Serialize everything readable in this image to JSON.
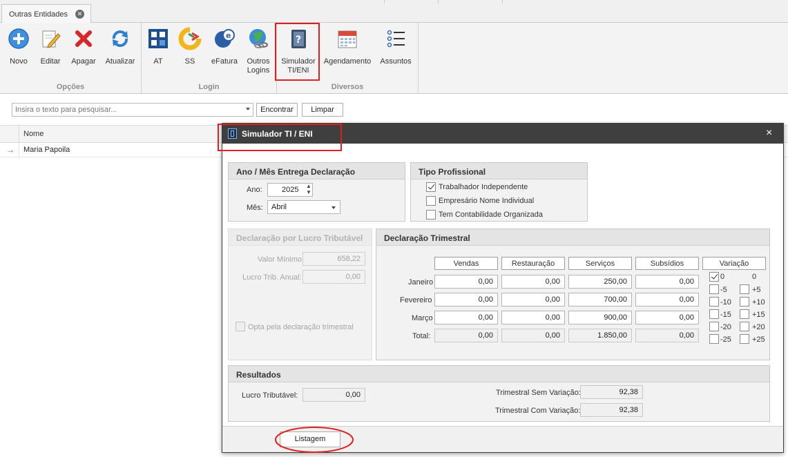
{
  "tab": {
    "label": "Outras Entidades"
  },
  "ribbon": {
    "groups": [
      {
        "title": "Opções",
        "buttons": [
          {
            "label": "Novo"
          },
          {
            "label": "Editar"
          },
          {
            "label": "Apagar"
          },
          {
            "label": "Atualizar"
          }
        ]
      },
      {
        "title": "Login",
        "buttons": [
          {
            "label": "AT"
          },
          {
            "label": "SS"
          },
          {
            "label": "eFatura"
          },
          {
            "label": "Outros\nLogins"
          }
        ]
      },
      {
        "title": "Diversos",
        "buttons": [
          {
            "label": "Simulador\nTI/ENI"
          },
          {
            "label": "Agendamento"
          },
          {
            "label": "Assuntos"
          }
        ]
      }
    ]
  },
  "search": {
    "placeholder": "Insira o texto para pesquisar...",
    "find_label": "Encontrar",
    "clear_label": "Limpar"
  },
  "grid": {
    "column": "Nome",
    "rows": [
      {
        "name": "Maria Papoila"
      }
    ]
  },
  "dialog": {
    "title": "Simulador TI / ENI",
    "close": "×",
    "entrega": {
      "title": "Ano / Mês Entrega Declaração",
      "ano_label": "Ano:",
      "ano_value": "2025",
      "mes_label": "Mês:",
      "mes_value": "Abril"
    },
    "tipo": {
      "title": "Tipo Profissional",
      "options": [
        {
          "label": "Trabalhador Independente",
          "checked": true
        },
        {
          "label": "Empresário Nome Individual",
          "checked": false
        },
        {
          "label": "Tem Contabilidade Organizada",
          "checked": false
        }
      ]
    },
    "lucro": {
      "title": "Declaração por Lucro Tributável",
      "valor_minimo_label": "Valor Mínimo:",
      "valor_minimo": "658,22",
      "lucro_anual_label": "Lucro Trib. Anual:",
      "lucro_anual": "0,00",
      "opta_label": "Opta pela declaração trimestral"
    },
    "trimestral": {
      "title": "Declaração Trimestral",
      "columns": [
        "Vendas",
        "Restauração",
        "Serviços",
        "Subsídios"
      ],
      "variacao_label": "Variação",
      "rows": [
        {
          "label": "Janeiro",
          "values": [
            "0,00",
            "0,00",
            "250,00",
            "0,00"
          ]
        },
        {
          "label": "Fevereiro",
          "values": [
            "0,00",
            "0,00",
            "700,00",
            "0,00"
          ]
        },
        {
          "label": "Março",
          "values": [
            "0,00",
            "0,00",
            "900,00",
            "0,00"
          ]
        }
      ],
      "total": {
        "label": "Total:",
        "values": [
          "0,00",
          "0,00",
          "1.850,00",
          "0,00"
        ]
      },
      "variacao_header_right": "0",
      "variacao_left": [
        {
          "label": "0",
          "checked": true
        },
        {
          "label": "-5"
        },
        {
          "label": "-10"
        },
        {
          "label": "-15"
        },
        {
          "label": "-20"
        },
        {
          "label": "-25"
        }
      ],
      "variacao_right": [
        {
          "label": "+5"
        },
        {
          "label": "+10"
        },
        {
          "label": "+15"
        },
        {
          "label": "+20"
        },
        {
          "label": "+25"
        }
      ]
    },
    "resultados": {
      "title": "Resultados",
      "lucro_label": "Lucro Tributável:",
      "lucro_value": "0,00",
      "sem_var_label": "Trimestral Sem Variação:",
      "sem_var_value": "92,38",
      "com_var_label": "Trimestral Com Variação:",
      "com_var_value": "92,38"
    },
    "listagem_label": "Listagem"
  },
  "colors": {
    "highlight": "#e02020",
    "dialog_title_bg": "#3f3f3f",
    "row_arrow": "#2a6fdb"
  }
}
